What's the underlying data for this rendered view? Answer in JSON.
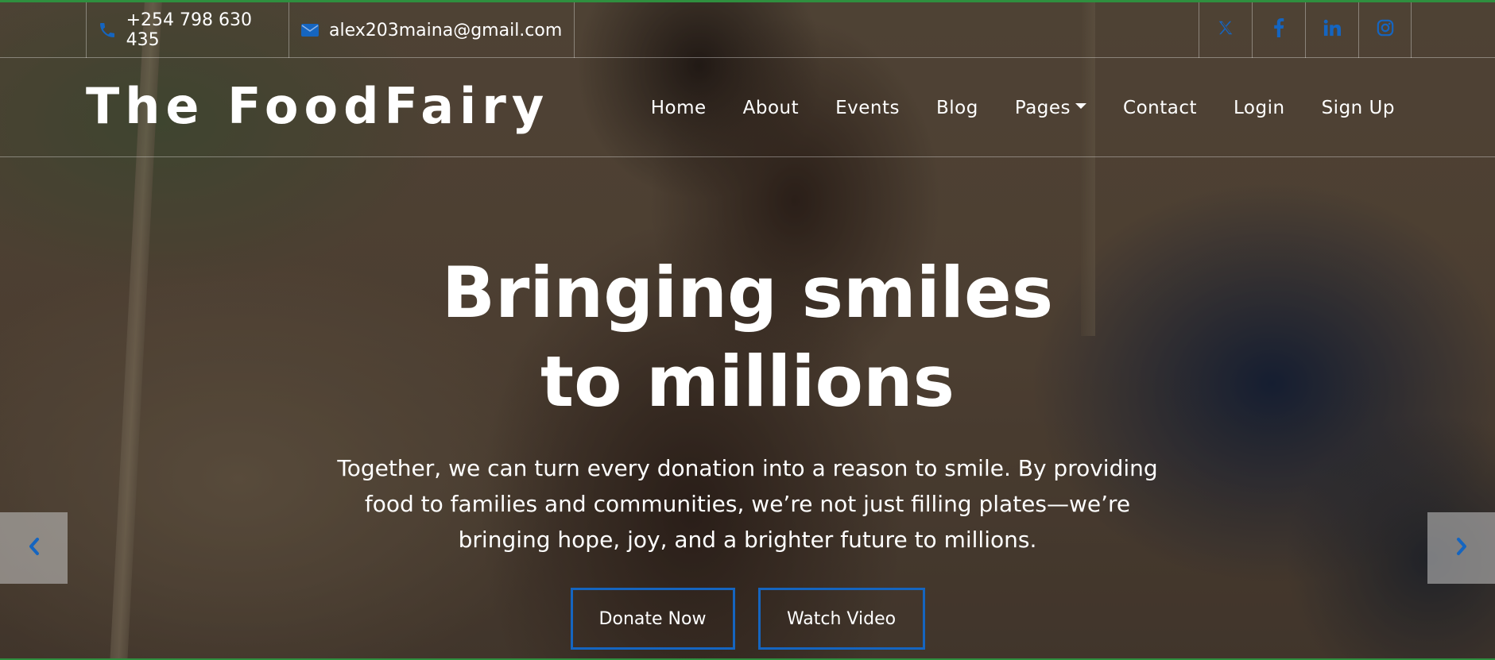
{
  "topbar": {
    "phone": "+254 798 630 435",
    "email": "alex203maina@gmail.com",
    "phone_icon": "phone-icon",
    "email_icon": "envelope-icon",
    "social": [
      {
        "name": "x-twitter-icon"
      },
      {
        "name": "facebook-icon"
      },
      {
        "name": "linkedin-icon"
      },
      {
        "name": "instagram-icon"
      }
    ],
    "icon_color": "#1565c0"
  },
  "navbar": {
    "brand": "The FoodFairy",
    "items": [
      {
        "label": "Home"
      },
      {
        "label": "About"
      },
      {
        "label": "Events"
      },
      {
        "label": "Blog"
      },
      {
        "label": "Pages",
        "dropdown": true
      },
      {
        "label": "Contact"
      },
      {
        "label": "Login"
      },
      {
        "label": "Sign Up"
      }
    ]
  },
  "hero": {
    "title": "Bringing smiles to millions",
    "text": "Together, we can turn every donation into a reason to smile. By providing food to families and communities, we’re not just filling plates—we’re bringing hope, joy, and a brighter future to millions.",
    "buttons": {
      "donate": "Donate Now",
      "watch": "Watch Video"
    },
    "button_border_color": "#1565c0"
  },
  "carousel": {
    "prev_icon": "chevron-left-icon",
    "next_icon": "chevron-right-icon"
  },
  "colors": {
    "accent": "#1565c0",
    "top_border": "#2f8f3f"
  }
}
